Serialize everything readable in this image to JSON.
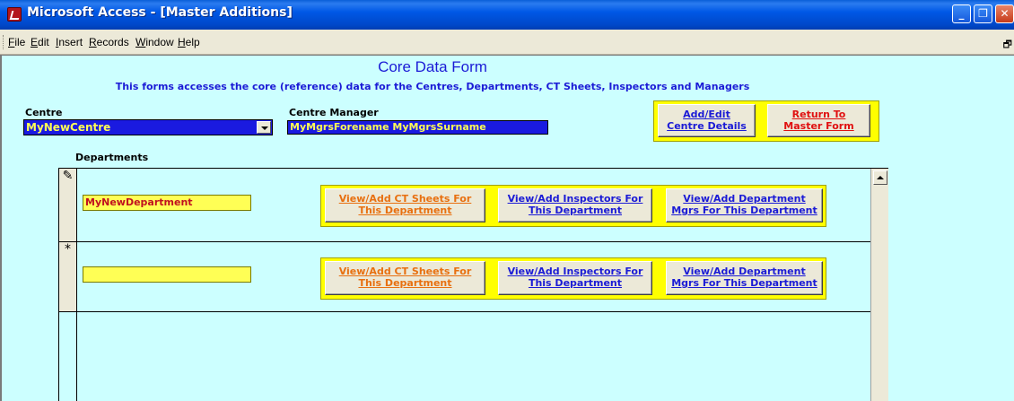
{
  "window": {
    "title": "Microsoft Access - [Master Additions]",
    "min_glyph": "_",
    "max_glyph": "❐",
    "close_glyph": "✕"
  },
  "menu": {
    "items": [
      "File",
      "Edit",
      "Insert",
      "Records",
      "Window",
      "Help"
    ],
    "restore_glyph": "🗗"
  },
  "form": {
    "title": "Core Data Form",
    "subtitle": "This forms accesses the core (reference) data for the Centres, Departments, CT Sheets, Inspectors and Managers",
    "centre_label": "Centre",
    "centre_value": "MyNewCentre",
    "manager_label": "Centre Manager",
    "manager_value": "MyMgrsForename MyMgrsSurname",
    "add_edit_centre": "Add/Edit\nCentre Details",
    "return_master": "Return To\nMaster Form",
    "departments_label": "Departments"
  },
  "subform": {
    "rows": [
      {
        "selector": "✎",
        "department": "MyNewDepartment",
        "ct_sheets": "View/Add CT Sheets For\nThis Department",
        "inspectors": "View/Add Inspectors For\nThis Department",
        "dept_mgrs": "View/Add Department\nMgrs For This Department"
      },
      {
        "selector": "*",
        "department": "",
        "ct_sheets": "View/Add CT Sheets For\nThis Department",
        "inspectors": "View/Add Inspectors For\nThis Department",
        "dept_mgrs": "View/Add Department\nMgrs For This Department"
      }
    ]
  },
  "colors": {
    "form_background": "#ccffff",
    "field_blue": "#1a1ae0",
    "highlight_yellow": "#ffff00",
    "button_face": "#ece9d8"
  }
}
